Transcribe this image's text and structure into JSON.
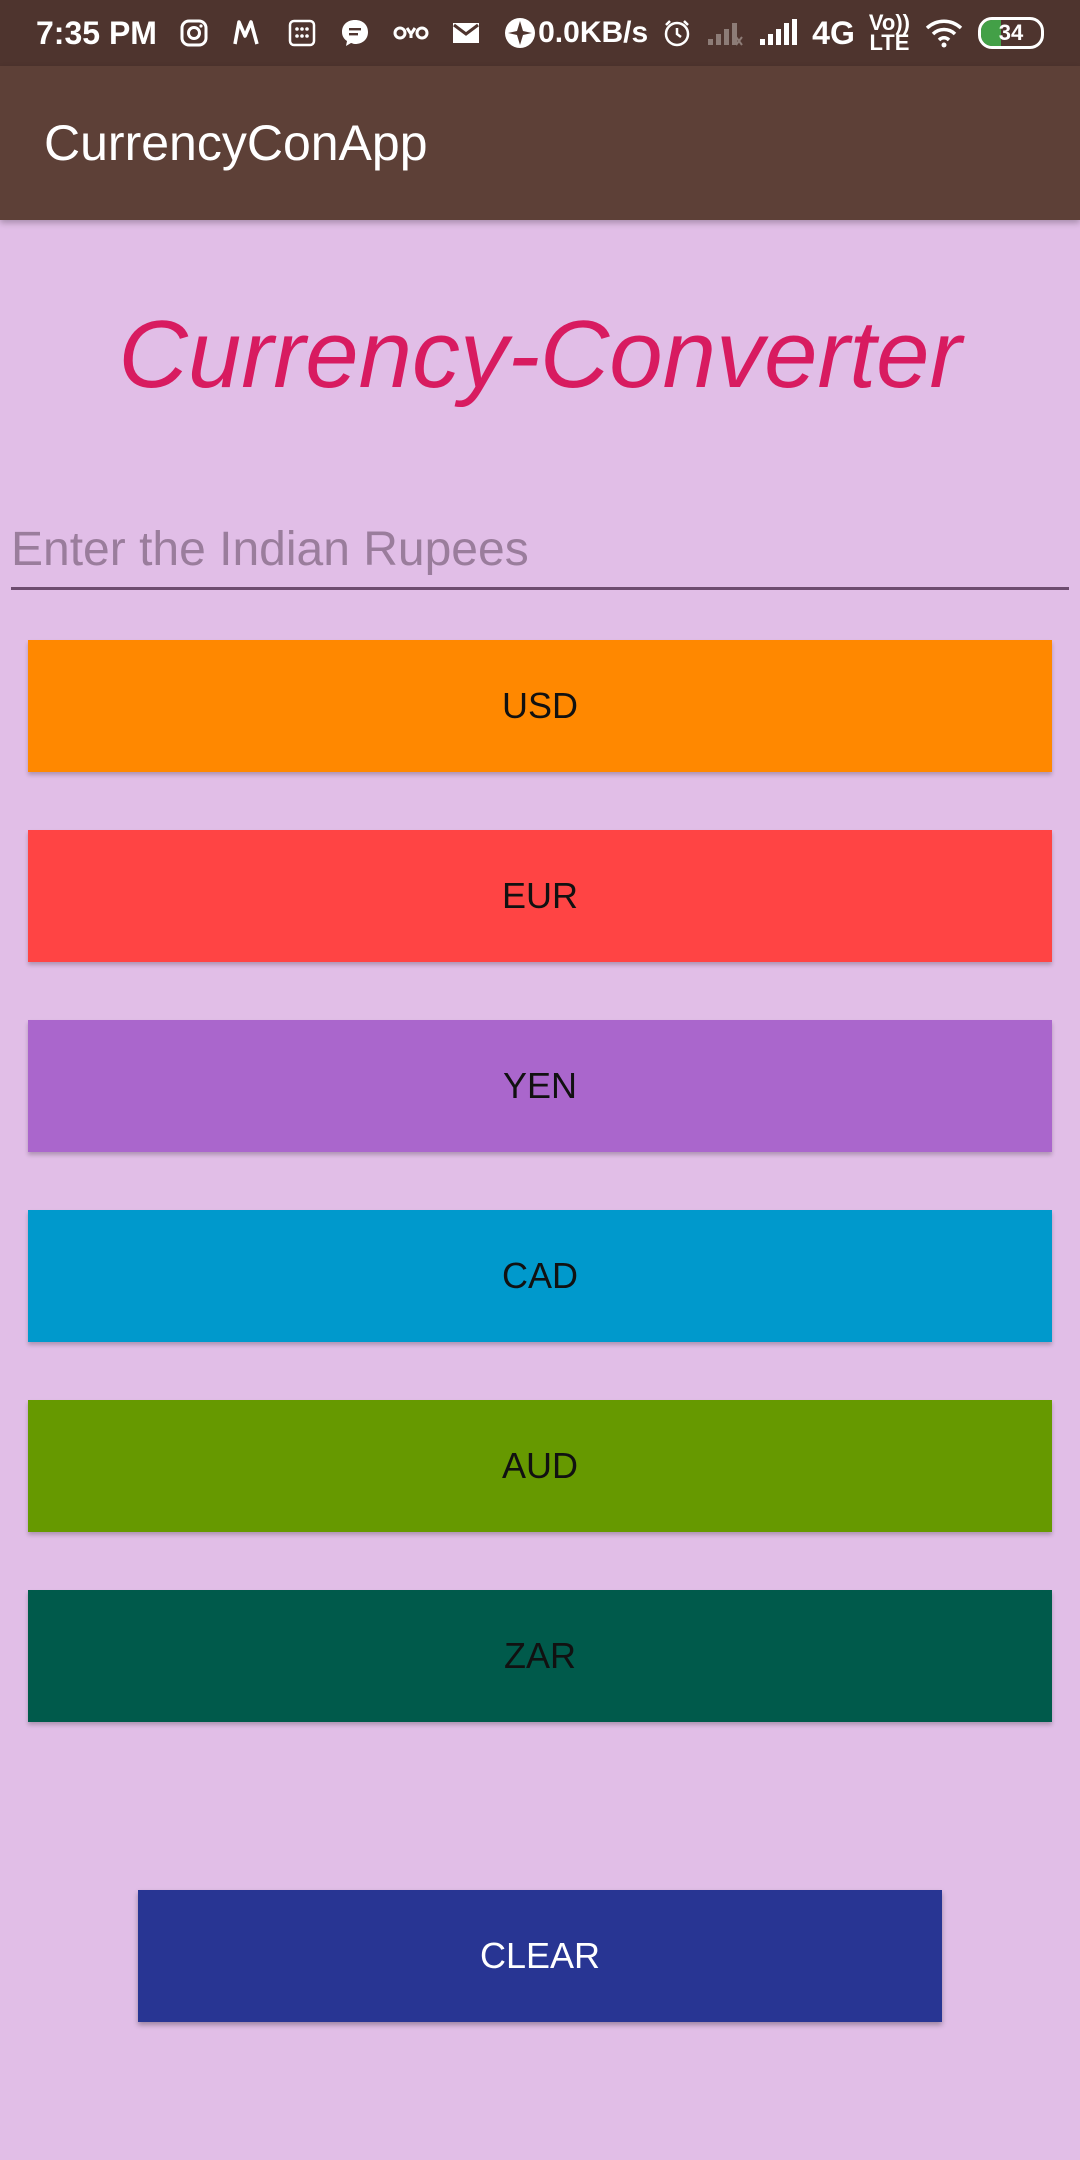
{
  "status_bar": {
    "time": "7:35 PM",
    "network_speed": "0.0KB/s",
    "network_type": "4G",
    "volte_top": "Vo))",
    "volte_bottom": "LTE",
    "battery_level": "34",
    "icons": [
      "instagram-icon",
      "myntra-icon",
      "calculator-icon",
      "message-icon",
      "oyo-icon",
      "mail-icon",
      "spinner-icon",
      "alarm-icon",
      "signal-weak-icon",
      "signal-strong-icon",
      "wifi-icon",
      "battery-icon"
    ]
  },
  "app_bar": {
    "title": "CurrencyConApp"
  },
  "main": {
    "heading": "Currency-Converter",
    "input_placeholder": "Enter the Indian Rupees",
    "input_value": "",
    "buttons": [
      {
        "label": "USD",
        "color": "#ff8800"
      },
      {
        "label": "EUR",
        "color": "#ff4444"
      },
      {
        "label": "YEN",
        "color": "#aa66cc"
      },
      {
        "label": "CAD",
        "color": "#0099cc"
      },
      {
        "label": "AUD",
        "color": "#669900"
      },
      {
        "label": "ZAR",
        "color": "#005a4b"
      }
    ],
    "clear_label": "CLEAR"
  },
  "colors": {
    "background": "#e1bee7",
    "app_bar": "#5d4037",
    "status_bar": "#4e342e",
    "heading": "#d81b60",
    "clear_button": "#283593"
  }
}
